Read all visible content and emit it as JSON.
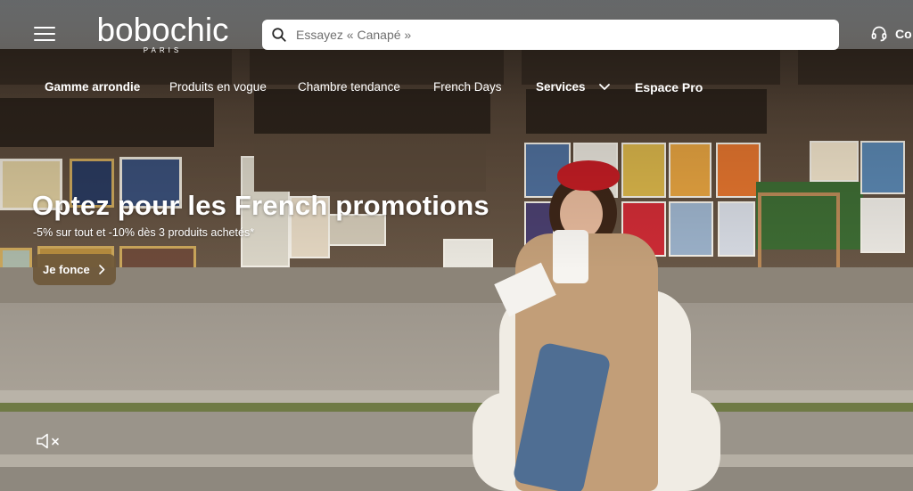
{
  "header": {
    "logo": {
      "name": "bobochic",
      "tagline": "PARIS"
    },
    "search": {
      "placeholder": "Essayez « Canapé »"
    },
    "contact_label": "Co"
  },
  "nav": {
    "items": [
      {
        "label": "Gamme arrondie"
      },
      {
        "label": "Produits en vogue"
      },
      {
        "label": "Chambre tendance"
      },
      {
        "label": "French Days"
      },
      {
        "label": "Services"
      },
      {
        "label": "Espace Pro"
      }
    ]
  },
  "hero": {
    "title": "Optez pour les French promotions",
    "subtitle": "-5% sur tout et -10% dès 3 produits achetés*",
    "cta_label": "Je fonce"
  },
  "icons": {
    "menu": "hamburger-menu-icon",
    "search": "search-icon",
    "contact": "headset-icon",
    "services_dropdown": "chevron-down-icon",
    "cta_arrow": "chevron-right-icon",
    "mute": "speaker-muted-icon"
  },
  "colors": {
    "cta_background": "#6e583a",
    "beret": "#c21d24",
    "text_on_image": "#ffffff"
  }
}
